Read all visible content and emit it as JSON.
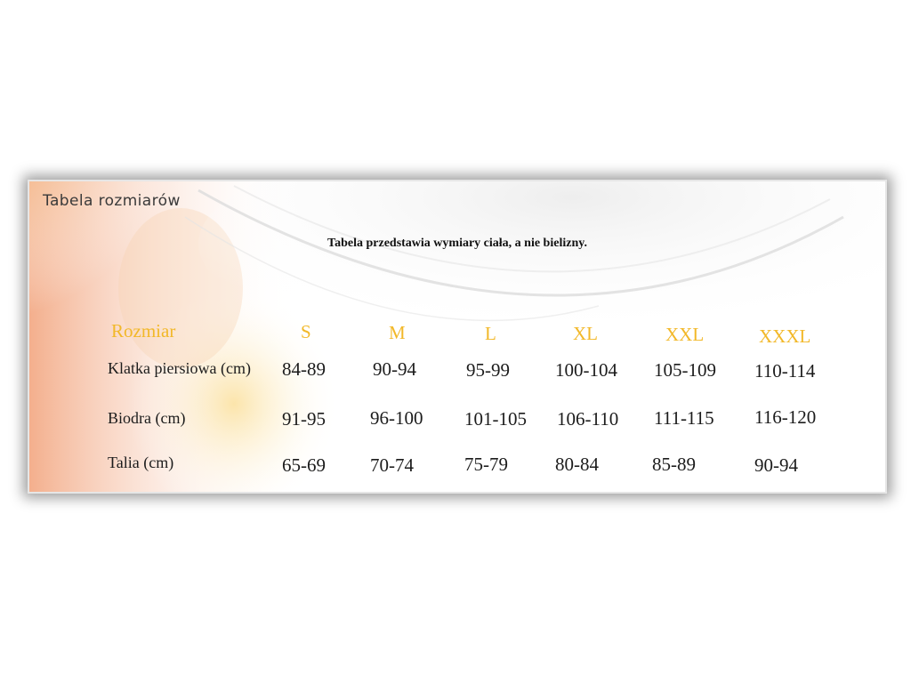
{
  "widget": {
    "title": "Tabela rozmiarów",
    "subtitle": "Tabela przedstawia wymiary ciała, a nie bielizny."
  },
  "table": {
    "corner_label": "Rozmiar",
    "sizes": [
      "S",
      "M",
      "L",
      "XL",
      "XXL",
      "XXXL"
    ],
    "rows": [
      {
        "label": "Klatka piersiowa (cm)",
        "values": [
          "84-89",
          "90-94",
          "95-99",
          "100-104",
          "105-109",
          "110-114"
        ]
      },
      {
        "label": "Biodra (cm)",
        "values": [
          "91-95",
          "96-100",
          "101-105",
          "106-110",
          "111-115",
          "116-120"
        ]
      },
      {
        "label": "Talia (cm)",
        "values": [
          "65-69",
          "70-74",
          "75-79",
          "80-84",
          "85-89",
          "90-94"
        ]
      }
    ]
  },
  "colors": {
    "header_text": "#f2b829",
    "body_text": "#1c1c1c",
    "skin_tone": "#f0a878",
    "warm_glow": "#fbe7a8"
  }
}
